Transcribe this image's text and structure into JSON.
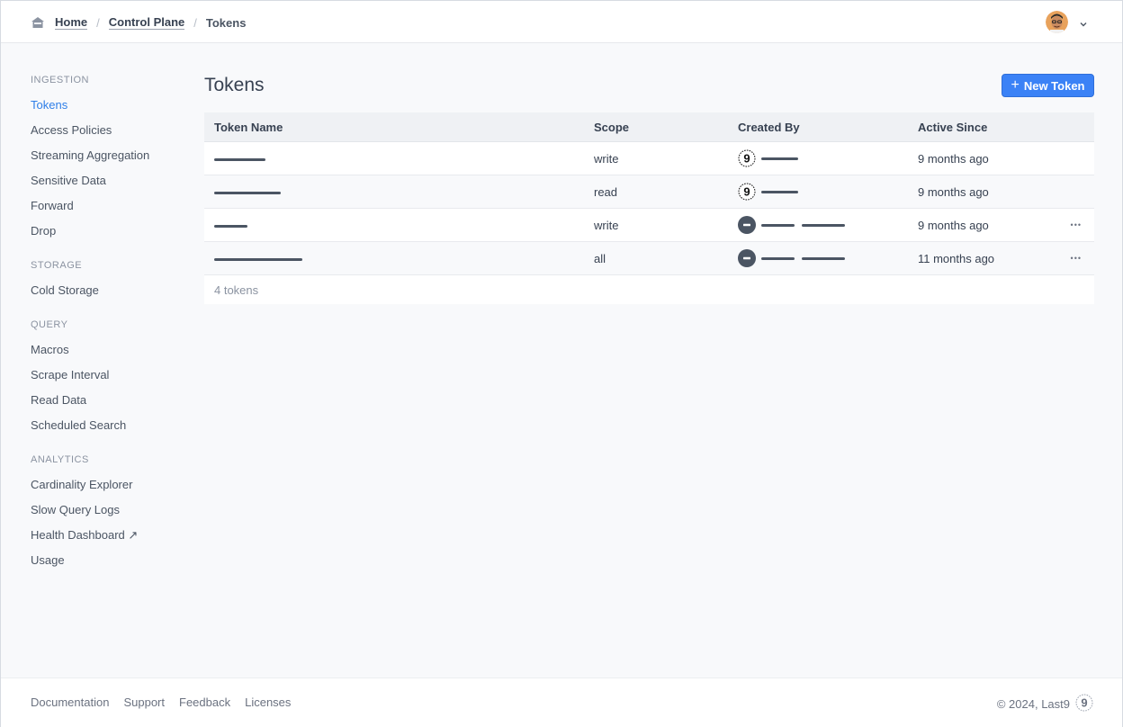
{
  "breadcrumb": {
    "home": "Home",
    "control_plane": "Control Plane",
    "current": "Tokens",
    "separator": "/"
  },
  "sidebar": {
    "sections": [
      {
        "title": "INGESTION",
        "items": [
          "Tokens",
          "Access Policies",
          "Streaming Aggregation",
          "Sensitive Data",
          "Forward",
          "Drop"
        ]
      },
      {
        "title": "STORAGE",
        "items": [
          "Cold Storage"
        ]
      },
      {
        "title": "QUERY",
        "items": [
          "Macros",
          "Scrape Interval",
          "Read Data",
          "Scheduled Search"
        ]
      },
      {
        "title": "ANALYTICS",
        "items": [
          "Cardinality Explorer",
          "Slow Query Logs",
          "Health Dashboard ↗",
          "Usage"
        ]
      }
    ],
    "active_item": "Tokens"
  },
  "main": {
    "title": "Tokens",
    "new_button_label": "New Token",
    "new_button_icon": "+",
    "columns": [
      "Token Name",
      "Scope",
      "Created By",
      "Active Since"
    ],
    "rows": [
      {
        "scope": "write",
        "creator_icon": "last9-logo-icon",
        "active_since": "9 months ago",
        "has_menu": false
      },
      {
        "scope": "read",
        "creator_icon": "last9-logo-icon",
        "active_since": "9 months ago",
        "has_menu": false
      },
      {
        "scope": "write",
        "creator_icon": "user-minus-icon",
        "active_since": "9 months ago",
        "has_menu": true,
        "menu_glyph": "•••"
      },
      {
        "scope": "all",
        "creator_icon": "user-minus-icon",
        "active_since": "11 months ago",
        "has_menu": true,
        "menu_glyph": "•••"
      }
    ],
    "count_label": "4 tokens"
  },
  "footer": {
    "links": [
      "Documentation",
      "Support",
      "Feedback",
      "Licenses"
    ],
    "copyright": "© 2024, Last9"
  },
  "colors": {
    "accent": "#3b82f6",
    "active_nav": "#2f7fe8",
    "text": "#374151",
    "muted": "#8b93a1"
  }
}
